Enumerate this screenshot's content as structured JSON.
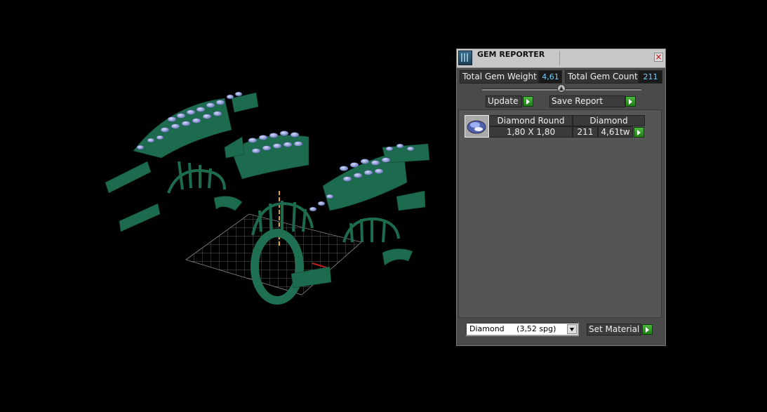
{
  "viewport": {
    "scene": "3D jewelry ring model, exploded view"
  },
  "panel": {
    "title": "GEM REPORTER",
    "close_label": "×",
    "total_weight_label": "Total Gem Weight",
    "total_weight_value": "4,61",
    "total_count_label": "Total Gem Count",
    "total_count_value": "211",
    "update_label": "Update",
    "save_report_label": "Save Report",
    "gem_rows": [
      {
        "shape": "Diamond Round",
        "material": "Diamond",
        "size": "1,80 X 1,80",
        "count": "211",
        "weight": "4,61tw"
      }
    ],
    "material_select_value": "Diamond     (3,52 spg)",
    "set_material_label": "Set Material"
  },
  "colors": {
    "accent_value": "#6fd0ff",
    "go_button": "#3aa62c",
    "model_green": "#1d6b4e",
    "gem_blue": "#8a9fd8"
  },
  "icons": [
    "gem-reporter-icon",
    "close-icon",
    "arrow-right-icon",
    "chevron-down-icon",
    "gem-thumbnail-icon"
  ]
}
